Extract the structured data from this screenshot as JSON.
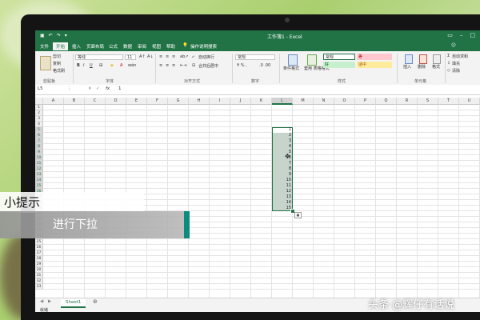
{
  "window": {
    "title": "工作簿1 - Excel"
  },
  "tabs": [
    "文件",
    "开始",
    "插入",
    "页面布局",
    "公式",
    "数据",
    "审阅",
    "视图",
    "帮助"
  ],
  "active_tab": "开始",
  "tell_me": "操作说明搜索",
  "ribbon": {
    "clipboard": {
      "cut": "剪切",
      "copy": "复制",
      "format_painter": "格式刷",
      "label": "剪贴板"
    },
    "font": {
      "name": "等线",
      "size": "11",
      "label": "字体"
    },
    "alignment": {
      "wrap": "自动换行",
      "merge": "合并后居中",
      "label": "对齐方式"
    },
    "number": {
      "format": "常规",
      "label": "数字"
    },
    "styles": {
      "cond_format": "条件格式",
      "table_format": "套用\n表格格式",
      "normal": "常规",
      "bad": "差",
      "good": "好",
      "neutral": "适中",
      "label": "样式"
    },
    "cells": {
      "insert": "插入",
      "delete": "删除",
      "format": "格式",
      "label": "单元格"
    },
    "editing": {
      "autosum": "自动求和",
      "fill": "填充",
      "clear": "清除"
    }
  },
  "formula_bar": {
    "name_box": "L5",
    "fx": "fx",
    "value": "1"
  },
  "columns": [
    "A",
    "B",
    "C",
    "D",
    "E",
    "F",
    "G",
    "H",
    "I",
    "J",
    "K",
    "L",
    "M",
    "N",
    "O",
    "P",
    "Q",
    "R",
    "S",
    "T",
    "U"
  ],
  "rows": [
    "1",
    "2",
    "3",
    "4",
    "5",
    "6",
    "7",
    "8",
    "9",
    "10",
    "11",
    "12",
    "13",
    "14",
    "15",
    "16",
    "17",
    "18",
    "19",
    "20",
    "21",
    "22",
    "23",
    "24",
    "25",
    "26",
    "27",
    "28",
    "29",
    "30",
    "31",
    "32",
    "33"
  ],
  "cell_values": [
    "1",
    "2",
    "3",
    "4",
    "5",
    "6",
    "7",
    "8",
    "9",
    "10",
    "11",
    "12",
    "13",
    "14",
    "15"
  ],
  "sheet_tab": "Sheet1",
  "status": "就绪",
  "overlay": {
    "tip_title": "小提示",
    "tip_text": "进行下拉"
  },
  "watermark": "头条 @辉仔有话说",
  "colors": {
    "excel_green": "#217346",
    "accent": "#0f8a7f"
  }
}
